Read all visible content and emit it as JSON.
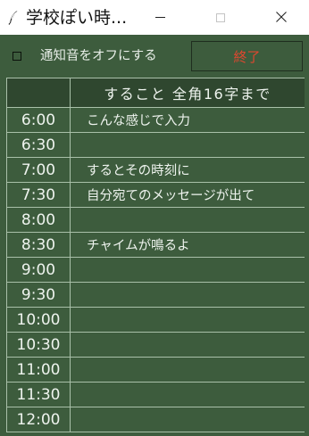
{
  "window": {
    "title": "学校ぽい時...",
    "icon": "feather-icon",
    "minimize_glyph": "—",
    "close_glyph": "✕"
  },
  "controls": {
    "mute_label": "通知音をオフにする",
    "mute_checked": false,
    "exit_label": "終了"
  },
  "colors": {
    "background": "#3d5c3d",
    "header_background": "#2f472f",
    "grid_line": "#a9c0a9",
    "text": "#eef3ee",
    "exit_text": "#e0472f"
  },
  "schedule": {
    "header_time": "",
    "header_task": "すること 全角16字まで",
    "rows": [
      {
        "time": "6:00",
        "task": "こんな感じで入力"
      },
      {
        "time": "6:30",
        "task": ""
      },
      {
        "time": "7:00",
        "task": "するとその時刻に"
      },
      {
        "time": "7:30",
        "task": "自分宛てのメッセージが出て"
      },
      {
        "time": "8:00",
        "task": ""
      },
      {
        "time": "8:30",
        "task": "チャイムが鳴るよ"
      },
      {
        "time": "9:00",
        "task": ""
      },
      {
        "time": "9:30",
        "task": ""
      },
      {
        "time": "10:00",
        "task": ""
      },
      {
        "time": "10:30",
        "task": ""
      },
      {
        "time": "11:00",
        "task": ""
      },
      {
        "time": "11:30",
        "task": ""
      },
      {
        "time": "12:00",
        "task": ""
      }
    ]
  }
}
